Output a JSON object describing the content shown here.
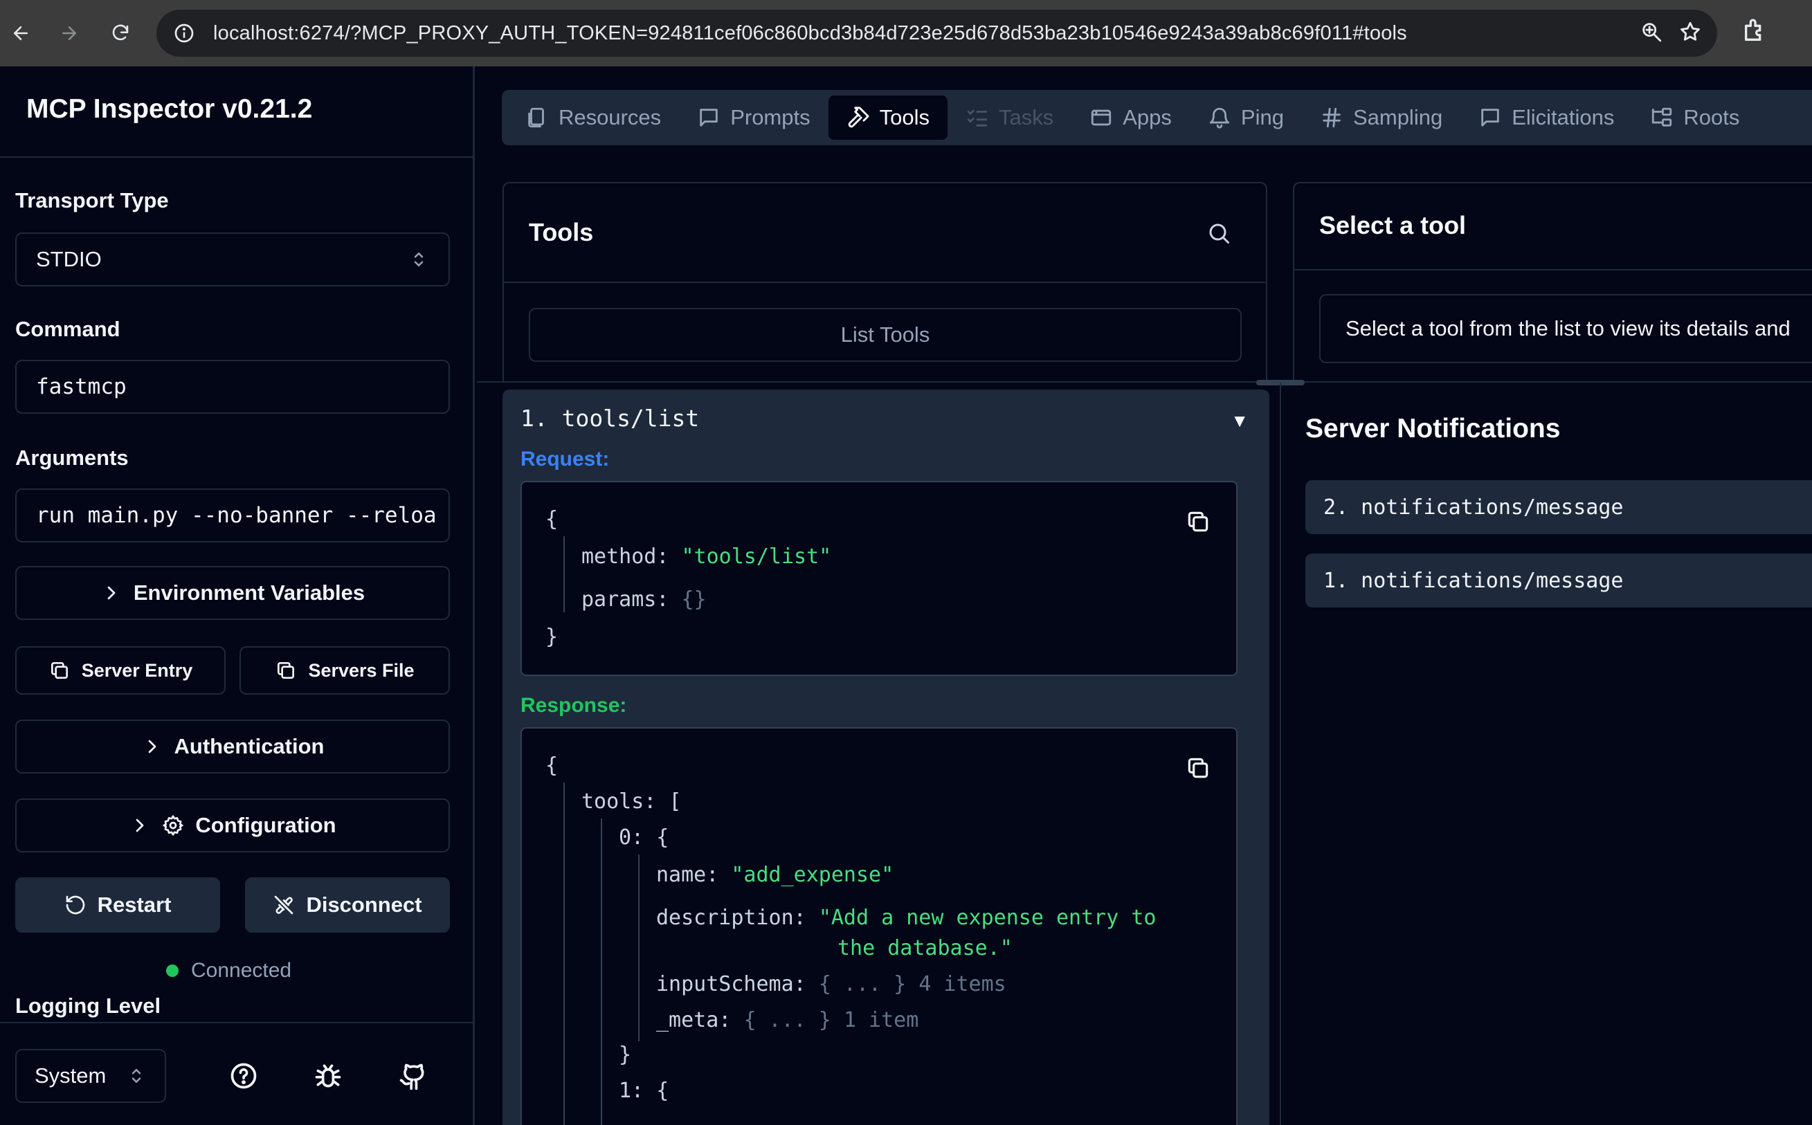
{
  "browser": {
    "url": "localhost:6274/?MCP_PROXY_AUTH_TOKEN=924811cef06c860bcd3b84d723e25d678d53ba23b10546e9243a39ab8c69f011#tools"
  },
  "sidebar": {
    "title": "MCP Inspector v0.21.2",
    "transport_label": "Transport Type",
    "transport_value": "STDIO",
    "command_label": "Command",
    "command_value": "fastmcp",
    "arguments_label": "Arguments",
    "arguments_value": "run main.py --no-banner --reloa",
    "env_vars_label": "Environment Variables",
    "server_entry_label": "Server Entry",
    "servers_file_label": "Servers File",
    "auth_label": "Authentication",
    "config_label": "Configuration",
    "restart_label": "Restart",
    "disconnect_label": "Disconnect",
    "status_text": "Connected",
    "status_color": "#22c55e",
    "logging_label": "Logging Level",
    "theme_value": "System"
  },
  "tabs": [
    {
      "label": "Resources",
      "icon": "file-icon"
    },
    {
      "label": "Prompts",
      "icon": "message-square-icon"
    },
    {
      "label": "Tools",
      "icon": "hammer-icon",
      "active": true
    },
    {
      "label": "Tasks",
      "icon": "list-checks-icon",
      "disabled": true
    },
    {
      "label": "Apps",
      "icon": "app-window-icon"
    },
    {
      "label": "Ping",
      "icon": "bell-icon"
    },
    {
      "label": "Sampling",
      "icon": "hash-icon"
    },
    {
      "label": "Elicitations",
      "icon": "message-square-icon"
    },
    {
      "label": "Roots",
      "icon": "folder-tree-icon"
    }
  ],
  "tools_panel": {
    "title": "Tools",
    "list_button": "List Tools"
  },
  "select_panel": {
    "title": "Select a tool",
    "message": "Select a tool from the list to view its details and"
  },
  "history": {
    "entry_title": "1.  tools/list",
    "toggle": "▼",
    "request_label": "Request:",
    "response_label": "Response:",
    "request": {
      "open": "{",
      "method_key": "method:",
      "method_val": "\"tools/list\"",
      "params_key": "params:",
      "params_val": "{}",
      "close": "}"
    },
    "response": {
      "open": "{",
      "tools_key": "tools:",
      "tools_open": "[",
      "item0_key": "0:",
      "item0_open": "{",
      "name_key": "name:",
      "name_val": "\"add_expense\"",
      "desc_key": "description:",
      "desc_line1": "\"Add a new expense entry to",
      "desc_line2": "the database.\"",
      "schema_key": "inputSchema:",
      "schema_val": "{ ... }",
      "schema_count": "4 items",
      "meta_key": "_meta:",
      "meta_val": "{ ... }",
      "meta_count": "1 item",
      "item0_close": "}",
      "item1_key": "1:",
      "item1_open": "{"
    }
  },
  "notifications": {
    "title": "Server Notifications",
    "items": [
      "2.  notifications/message",
      "1.  notifications/message"
    ]
  }
}
